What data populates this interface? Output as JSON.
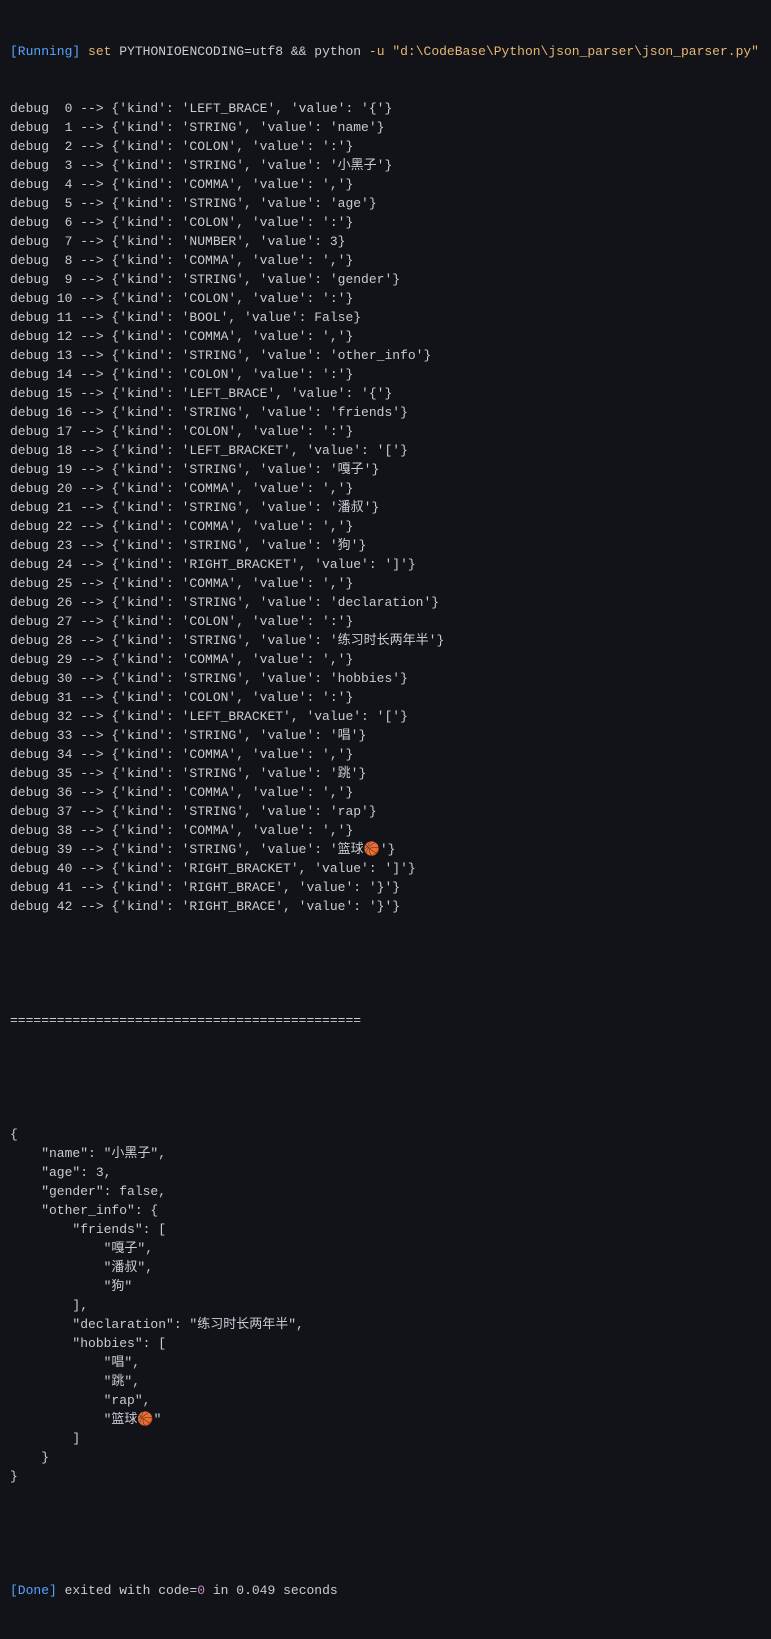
{
  "header": {
    "running_label": "[Running]",
    "cmd_set": "set",
    "cmd_env": "PYTHONIOENCODING=utf8 && python",
    "cmd_flag": "-u",
    "cmd_path": "\"d:\\CodeBase\\Python\\json_parser\\json_parser.py\""
  },
  "tokens": [
    {
      "i": 0,
      "k": "LEFT_BRACE",
      "v": "{"
    },
    {
      "i": 1,
      "k": "STRING",
      "v": "name"
    },
    {
      "i": 2,
      "k": "COLON",
      "v": ":"
    },
    {
      "i": 3,
      "k": "STRING",
      "v": "小黑子"
    },
    {
      "i": 4,
      "k": "COMMA",
      "v": ","
    },
    {
      "i": 5,
      "k": "STRING",
      "v": "age"
    },
    {
      "i": 6,
      "k": "COLON",
      "v": ":"
    },
    {
      "i": 7,
      "k": "NUMBER",
      "v": 3
    },
    {
      "i": 8,
      "k": "COMMA",
      "v": ","
    },
    {
      "i": 9,
      "k": "STRING",
      "v": "gender"
    },
    {
      "i": 10,
      "k": "COLON",
      "v": ":"
    },
    {
      "i": 11,
      "k": "BOOL",
      "v": "False"
    },
    {
      "i": 12,
      "k": "COMMA",
      "v": ","
    },
    {
      "i": 13,
      "k": "STRING",
      "v": "other_info"
    },
    {
      "i": 14,
      "k": "COLON",
      "v": ":"
    },
    {
      "i": 15,
      "k": "LEFT_BRACE",
      "v": "{"
    },
    {
      "i": 16,
      "k": "STRING",
      "v": "friends"
    },
    {
      "i": 17,
      "k": "COLON",
      "v": ":"
    },
    {
      "i": 18,
      "k": "LEFT_BRACKET",
      "v": "["
    },
    {
      "i": 19,
      "k": "STRING",
      "v": "嘎子"
    },
    {
      "i": 20,
      "k": "COMMA",
      "v": ","
    },
    {
      "i": 21,
      "k": "STRING",
      "v": "潘叔"
    },
    {
      "i": 22,
      "k": "COMMA",
      "v": ","
    },
    {
      "i": 23,
      "k": "STRING",
      "v": "狗"
    },
    {
      "i": 24,
      "k": "RIGHT_BRACKET",
      "v": "]"
    },
    {
      "i": 25,
      "k": "COMMA",
      "v": ","
    },
    {
      "i": 26,
      "k": "STRING",
      "v": "declaration"
    },
    {
      "i": 27,
      "k": "COLON",
      "v": ":"
    },
    {
      "i": 28,
      "k": "STRING",
      "v": "练习时长两年半"
    },
    {
      "i": 29,
      "k": "COMMA",
      "v": ","
    },
    {
      "i": 30,
      "k": "STRING",
      "v": "hobbies"
    },
    {
      "i": 31,
      "k": "COLON",
      "v": ":"
    },
    {
      "i": 32,
      "k": "LEFT_BRACKET",
      "v": "["
    },
    {
      "i": 33,
      "k": "STRING",
      "v": "唱"
    },
    {
      "i": 34,
      "k": "COMMA",
      "v": ","
    },
    {
      "i": 35,
      "k": "STRING",
      "v": "跳"
    },
    {
      "i": 36,
      "k": "COMMA",
      "v": ","
    },
    {
      "i": 37,
      "k": "STRING",
      "v": "rap"
    },
    {
      "i": 38,
      "k": "COMMA",
      "v": ","
    },
    {
      "i": 39,
      "k": "STRING",
      "v": "篮球🏀"
    },
    {
      "i": 40,
      "k": "RIGHT_BRACKET",
      "v": "]"
    },
    {
      "i": 41,
      "k": "RIGHT_BRACE",
      "v": "}"
    },
    {
      "i": 42,
      "k": "RIGHT_BRACE",
      "v": "}"
    }
  ],
  "separator": "=============================================",
  "json_output": "{\n    \"name\": \"小黑子\",\n    \"age\": 3,\n    \"gender\": false,\n    \"other_info\": {\n        \"friends\": [\n            \"嘎子\",\n            \"潘叔\",\n            \"狗\"\n        ],\n        \"declaration\": \"练习时长两年半\",\n        \"hobbies\": [\n            \"唱\",\n            \"跳\",\n            \"rap\",\n            \"篮球🏀\"\n        ]\n    }\n}",
  "footer": {
    "done_label": "[Done]",
    "exited_text": " exited with ",
    "code_label": "code=",
    "code_value": "0",
    "in_text": " in ",
    "seconds_value": "0.049",
    "seconds_label": " seconds"
  }
}
